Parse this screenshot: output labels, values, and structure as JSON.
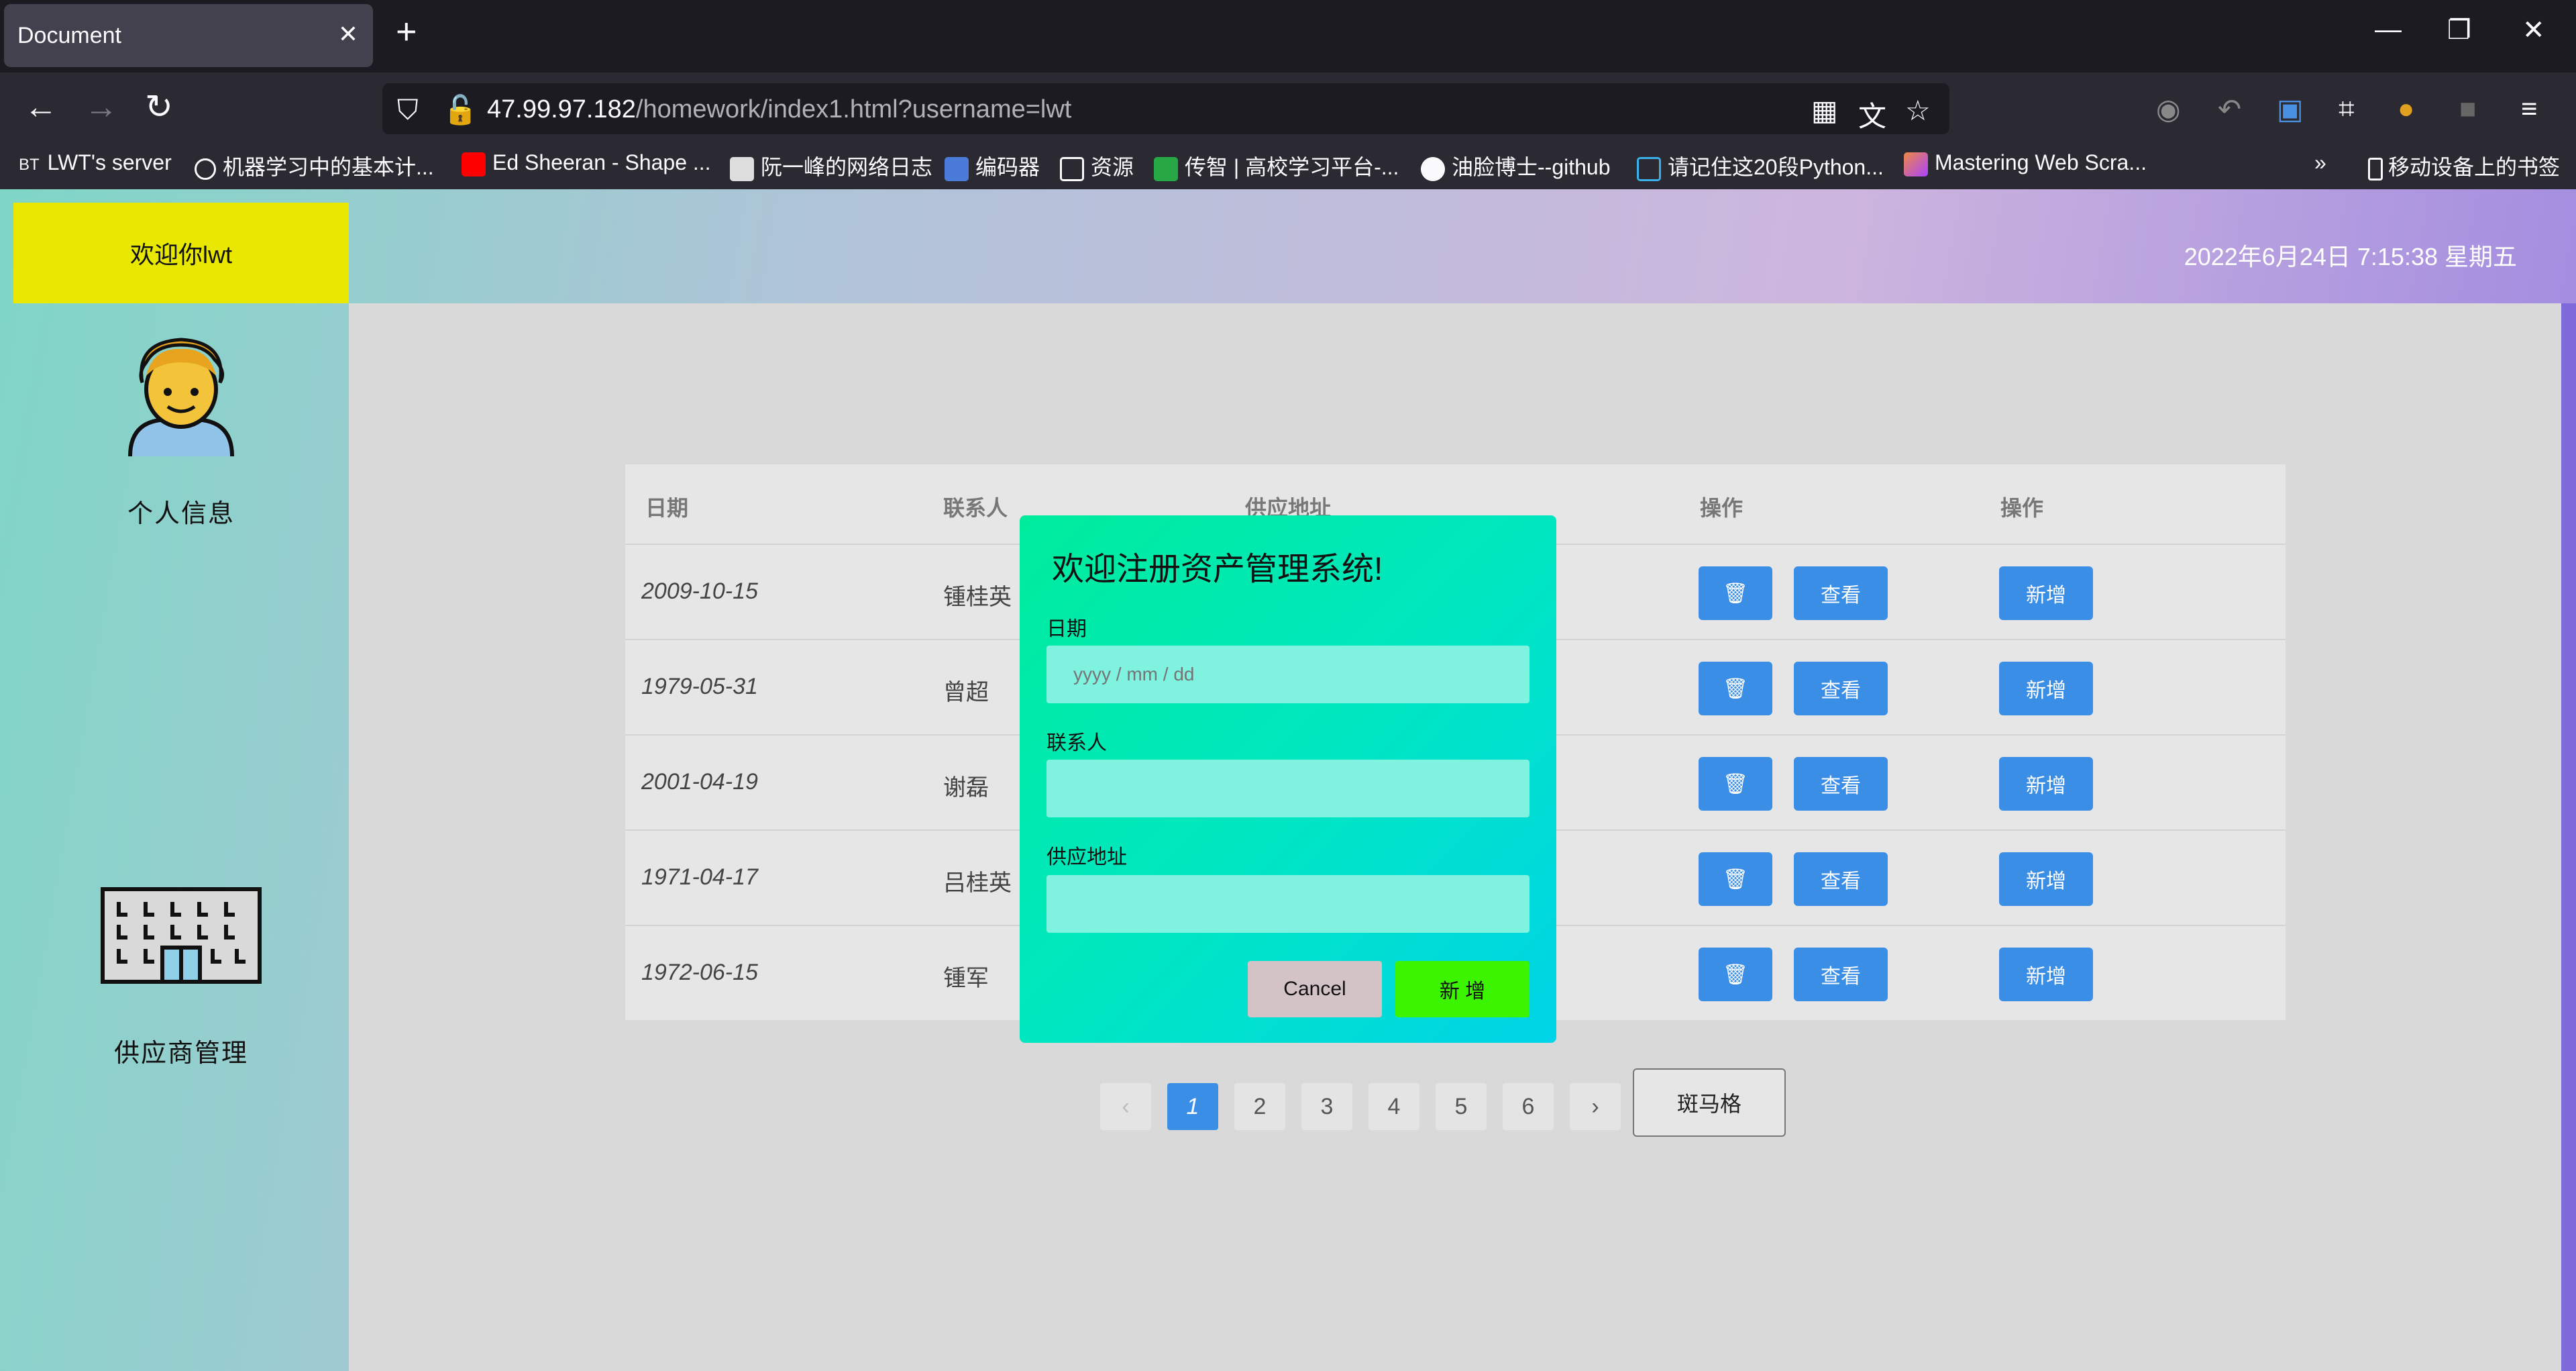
{
  "browser": {
    "tab_title": "Document",
    "url_host": "47.99.97.182",
    "url_path": "/homework/index1.html?username=lwt",
    "bookmarks": [
      "LWT's server",
      "机器学习中的基本计...",
      "Ed Sheeran - Shape ...",
      "阮一峰的网络日志",
      "编码器",
      "资源",
      "传智 | 高校学习平台-...",
      "油脸博士--github",
      "请记住这20段Python...",
      "Mastering Web Scra..."
    ],
    "mobile_bookmarks": "移动设备上的书签"
  },
  "header": {
    "welcome": "欢迎你lwt",
    "datetime": "2022年6月24日 7:15:38 星期五"
  },
  "sidebar": {
    "personal_info": "个人信息",
    "supplier_mgmt": "供应商管理"
  },
  "table": {
    "headers": [
      "日期",
      "联系人",
      "供应地址",
      "操作",
      "操作"
    ],
    "rows": [
      {
        "date": "2009-10-15",
        "contact": "锺桂英"
      },
      {
        "date": "1979-05-31",
        "contact": "曾超"
      },
      {
        "date": "2001-04-19",
        "contact": "谢磊"
      },
      {
        "date": "1971-04-17",
        "contact": "吕桂英"
      },
      {
        "date": "1972-06-15",
        "contact": "锺军"
      }
    ],
    "delete_icon": "trash-icon",
    "view_label": "查看",
    "add_label": "新增"
  },
  "pagination": {
    "pages": [
      "1",
      "2",
      "3",
      "4",
      "5",
      "6"
    ],
    "current": 1,
    "zebra_label": "斑马格"
  },
  "modal": {
    "title": "欢迎注册资产管理系统!",
    "date_label": "日期",
    "date_placeholder": "yyyy / mm / dd",
    "contact_label": "联系人",
    "address_label": "供应地址",
    "cancel_label": "Cancel",
    "add_label": "新 增"
  },
  "colors": {
    "welcome_bg": "#e8e800",
    "button_blue": "#3b8ee6",
    "modal_add": "#3cf400"
  }
}
